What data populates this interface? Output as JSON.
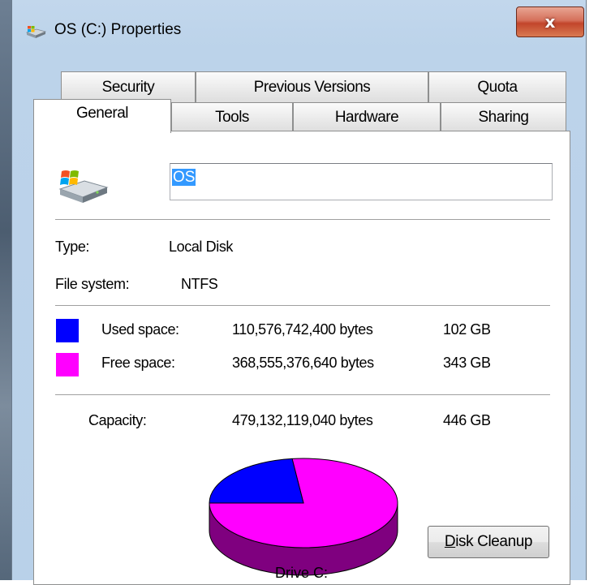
{
  "window": {
    "title": "OS (C:) Properties",
    "close_label": "x"
  },
  "tabs": [
    {
      "label": "Security"
    },
    {
      "label": "Previous Versions"
    },
    {
      "label": "Quota"
    },
    {
      "label": "General",
      "selected": true
    },
    {
      "label": "Tools"
    },
    {
      "label": "Hardware"
    },
    {
      "label": "Sharing"
    }
  ],
  "general": {
    "volume_name": "OS",
    "type_label": "Type:",
    "type_value": "Local Disk",
    "fs_label": "File system:",
    "fs_value": "NTFS",
    "used_label": "Used space:",
    "used_bytes": "110,576,742,400 bytes",
    "used_gb": "102 GB",
    "free_label": "Free space:",
    "free_bytes": "368,555,376,640 bytes",
    "free_gb": "343 GB",
    "capacity_label": "Capacity:",
    "capacity_bytes": "479,132,119,040 bytes",
    "capacity_gb": "446 GB",
    "drive_label": "Drive C:",
    "cleanup_first": "D",
    "cleanup_rest": "isk Cleanup"
  },
  "colors": {
    "used": "#0000ff",
    "free": "#ff00ff",
    "used_side": "#00007f",
    "free_side": "#7f007f"
  },
  "chart_data": {
    "type": "pie",
    "categories": [
      "Used space",
      "Free space"
    ],
    "values": [
      110576742400,
      368555376640
    ]
  }
}
